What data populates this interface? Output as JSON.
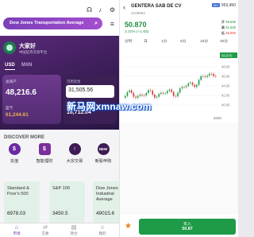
{
  "left": {
    "status_time": "",
    "search_text": "Dow Jones Transportation Average",
    "account": {
      "greeting": "大家好",
      "subtitle": "中国证券交易平台",
      "tabs": [
        "USD",
        "MXN"
      ],
      "total_assets_label": "总资产",
      "total_assets_value": "48,216.6",
      "available_label": "可用资金",
      "available_value": "31,505.56",
      "market_label": "盈亏",
      "market_value": "61,244.61",
      "card2_bottom_value": "16,711.04"
    },
    "discover_title": "DISCOVER MORE",
    "quick_actions": [
      {
        "label": "充值",
        "icon": "$"
      },
      {
        "label": "智能理财",
        "icon": "$"
      },
      {
        "label": "大宗交易",
        "icon": "↑"
      },
      {
        "label": "新股申购",
        "icon": "NEW"
      }
    ],
    "indices": [
      {
        "name": "Standard & Poor's 500",
        "value": "6978.03"
      },
      {
        "name": "S&P 100",
        "value": "3450.5"
      },
      {
        "name": "Dow Jones Industrial Average",
        "value": "49015.6"
      }
    ],
    "bottom_nav": [
      {
        "label": "市场",
        "icon": "⌂"
      },
      {
        "label": "交易",
        "icon": "⇄"
      },
      {
        "label": "持仓",
        "icon": "▤"
      },
      {
        "label": "我的",
        "icon": "☺"
      }
    ],
    "watermark": "新马网xmnaw.com"
  },
  "right": {
    "stock_name": "GENTERA SAB DE CV",
    "stock_code": "2228652",
    "top_right_value": "953,450",
    "price": "50.870",
    "change": "3.31% (+1.63)",
    "ohl": [
      {
        "label": "开",
        "value": "49.630"
      },
      {
        "label": "高",
        "value": "51.620"
      },
      {
        "label": "低",
        "value": "49.000"
      }
    ],
    "timeframes": [
      "分时",
      "日",
      "1分",
      "5分",
      "15分",
      "30分"
    ],
    "price_axis": [
      "50.00",
      "48.00",
      "46.00",
      "44.00",
      "42.00",
      "40.00"
    ],
    "date_label": "2026",
    "buy_label": "买入",
    "buy_value": "50.87",
    "colors": {
      "up": "#1e9a48",
      "down": "#d33333",
      "brand": "#6b2aa3"
    }
  }
}
